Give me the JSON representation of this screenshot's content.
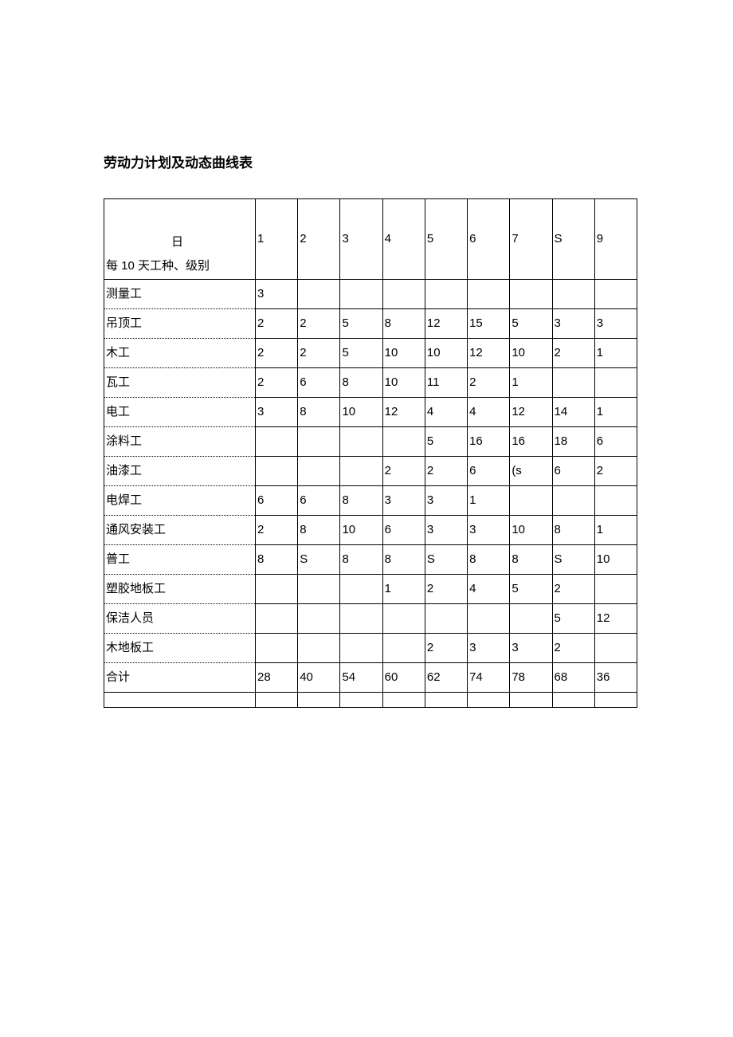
{
  "title": "劳动力计划及动态曲线表",
  "header": {
    "day_label": "日",
    "sub_label": "每 10 天工种、级别",
    "cols": [
      "1",
      "2",
      "3",
      "4",
      "5",
      "6",
      "7",
      "S",
      "9"
    ]
  },
  "rows": [
    {
      "label": "测量工",
      "cells": [
        "3",
        "",
        "",
        "",
        "",
        "",
        "",
        "",
        ""
      ]
    },
    {
      "label": "吊顶工",
      "cells": [
        "2",
        "2",
        "5",
        "8",
        "12",
        "15",
        "5",
        "3",
        "3"
      ]
    },
    {
      "label": "木工",
      "cells": [
        "2",
        "2",
        "5",
        "10",
        "10",
        "12",
        "10",
        "2",
        "1"
      ]
    },
    {
      "label": "瓦工",
      "cells": [
        "2",
        "6",
        "8",
        "10",
        "11",
        "2",
        "1",
        "",
        ""
      ]
    },
    {
      "label": "电工",
      "cells": [
        "3",
        "8",
        "10",
        "12",
        "4",
        "4",
        "12",
        "14",
        "1"
      ]
    },
    {
      "label": "涂料工",
      "cells": [
        "",
        "",
        "",
        "",
        "5",
        "16",
        "16",
        "18",
        "6"
      ]
    },
    {
      "label": "油漆工",
      "cells": [
        "",
        "",
        "",
        "2",
        "2",
        "6",
        "(s",
        "6",
        "2"
      ]
    },
    {
      "label": "电焊工",
      "cells": [
        "6",
        "6",
        "8",
        "3",
        "3",
        "1",
        "",
        "",
        ""
      ]
    },
    {
      "label": "通风安装工",
      "cells": [
        "2",
        "8",
        "10",
        "6",
        "3",
        "3",
        "10",
        "8",
        "1"
      ]
    },
    {
      "label": "普工",
      "cells": [
        "8",
        "S",
        "8",
        "8",
        "S",
        "8",
        "8",
        "S",
        "10"
      ]
    },
    {
      "label": "塑胶地板工",
      "cells": [
        "",
        "",
        "",
        "1",
        "2",
        "4",
        "5",
        "2",
        ""
      ]
    },
    {
      "label": "保洁人员",
      "cells": [
        "",
        "",
        "",
        "",
        "",
        "",
        "",
        "5",
        "12"
      ]
    },
    {
      "label": "木地板工",
      "cells": [
        "",
        "",
        "",
        "",
        "2",
        "3",
        "3",
        "2",
        ""
      ]
    },
    {
      "label": "合计",
      "cells": [
        "28",
        "40",
        "54",
        "60",
        "62",
        "74",
        "78",
        "68",
        "36"
      ]
    }
  ]
}
